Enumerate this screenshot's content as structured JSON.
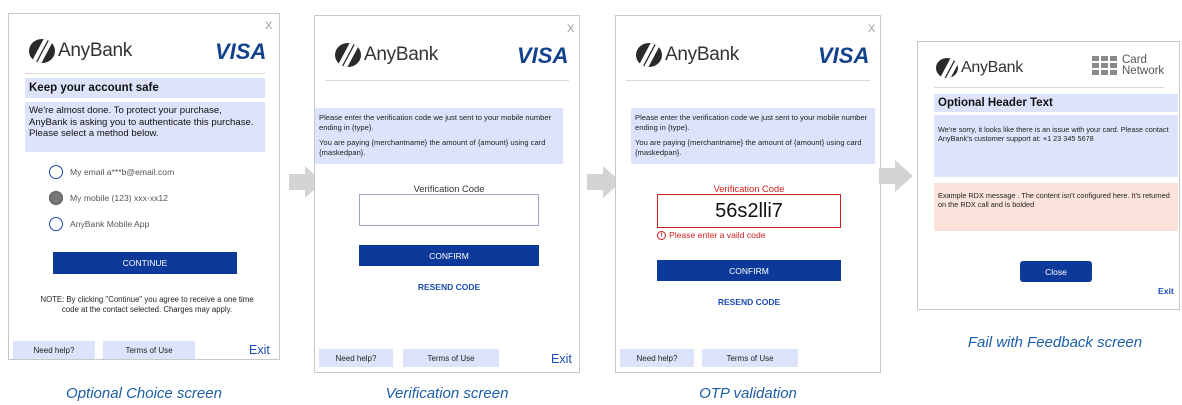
{
  "colors": {
    "primary": "#0d3a9a",
    "panel": "#dde3fb",
    "error": "#d11f1f",
    "caption": "#1d5ea8",
    "visa": "#13428d"
  },
  "screen1": {
    "close": "X",
    "bank": "AnyBank",
    "network": "VISA",
    "heading": "Keep your account safe",
    "intro": "We're almost done. To protect your purchase, AnyBank is asking you to authenticate this purchase. Please select a method below.",
    "options": [
      {
        "label": "My email a***b@email.com",
        "selected": false
      },
      {
        "label": "My mobile (123) xxx-xx12",
        "selected": true
      },
      {
        "label": "AnyBank Mobile App",
        "selected": false
      }
    ],
    "continue_label": "CONTINUE",
    "note": "NOTE: By clicking \"Continue\" you agree to receive a one time code at the contact selected. Charges may apply.",
    "help": "Need help?",
    "terms": "Terms of Use",
    "exit": "Exit",
    "caption": "Optional Choice screen"
  },
  "screen2": {
    "close": "X",
    "bank": "AnyBank",
    "network": "VISA",
    "para1": "Please enter the verification code we just sent to your mobile number ending in {type}.",
    "para2": "You are paying {merchantname} the amount of {amount} using card {maskedpan}.",
    "code_label": "Verification Code",
    "code_value": "",
    "confirm_label": "CONFIRM",
    "resend_label": "RESEND CODE",
    "help": "Need help?",
    "terms": "Terms of Use",
    "exit": "Exit",
    "caption": "Verification screen"
  },
  "screen3": {
    "close": "X",
    "bank": "AnyBank",
    "network": "VISA",
    "para1": "Please enter the verification code we just sent to your mobile number ending in {type}.",
    "para2": "You are paying {merchantname} the amount of {amount} using card {maskedpan}.",
    "code_label": "Verification Code",
    "code_value": "56s2lli7",
    "error_icon": "!",
    "error_text": "Please enter a vaild code",
    "confirm_label": "CONFIRM",
    "resend_label": "RESEND CODE",
    "help": "Need help?",
    "terms": "Terms of Use",
    "caption": "OTP validation"
  },
  "screen4": {
    "bank": "AnyBank",
    "network": "Card Network",
    "network_line1": "Card",
    "network_line2": "Network",
    "header": "Optional Header Text",
    "message": "We're sorry, it looks like there is an issue with your card. Please contact AnyBank's customer support at: +1 23 345 5678",
    "rdx": "Example RDX message . The content isn't configured here. It's returned on the RDX call and is bolded",
    "close_label": "Close",
    "exit": "Exit",
    "caption": "Fail with Feedback screen"
  }
}
